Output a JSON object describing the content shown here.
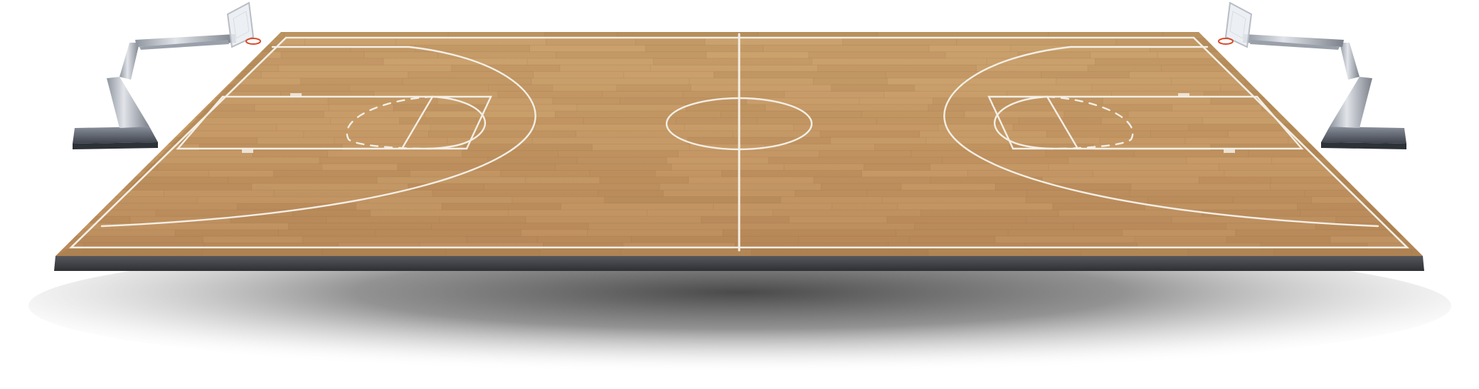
{
  "scene": {
    "subject": "basketball-court",
    "background_color": "#ffffff",
    "floor_color": "#c49a66",
    "floor_edge_color": "#9f7748",
    "line_color": "#f4efe6",
    "slab_color": "#3d3e42",
    "shadow_color": "#2e2e2e",
    "hoop_frame_color": "#b9bdc4",
    "hoop_base_color": "#5c6270",
    "rim_color": "#d64b2a"
  }
}
